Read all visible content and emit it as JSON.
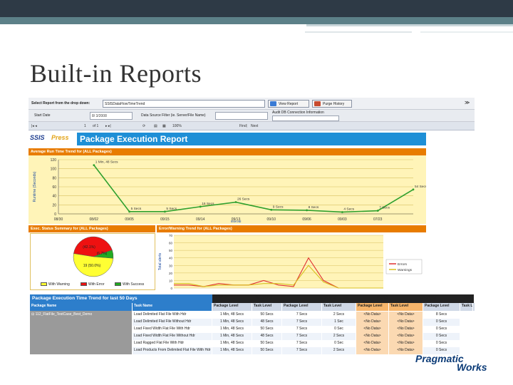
{
  "slide": {
    "title": "Built-in Reports",
    "logo_line1": "Pragmatic",
    "logo_line2": "Works"
  },
  "toolbar": {
    "select_label": "Select Report from the drop down:",
    "report_value": "SSISDataFlowTimeTrend",
    "view_button": "View Report",
    "purge_button": "Purge History",
    "start_date_label": "Start Date",
    "start_date_value": "8/ 3/2008",
    "filter_label": "Data Source Filter (ie. Server/File Name)",
    "audit_label": "Audit DB Connection Information",
    "page_current": "1",
    "page_of": "of 1",
    "zoom": "100%",
    "find": "Find",
    "next": "Next",
    "close_glyph": "≫"
  },
  "report": {
    "logo_ssis": "SSIS",
    "logo_press": "Press",
    "title": "Package Execution Report",
    "runtime_title": "Average Run Time Trend for (ALL Packages)",
    "status_title": "Exec. Status Summary for (ALL Packages)",
    "error_title": "Error/Warning Trend for (ALL Packages)",
    "table_title": "Package Execution Time Trend for last 50 Days"
  },
  "chart_data": [
    {
      "type": "line",
      "title": "Average Run Time Trend for (ALL Packages)",
      "ylabel": "Runtime (Seconds)",
      "xlabel": "Interval",
      "ylim": [
        0,
        120
      ],
      "yticks": [
        0,
        20,
        40,
        60,
        80,
        100,
        120
      ],
      "categories": [
        "08/30",
        "08/02",
        "09/05",
        "09/15",
        "09/14",
        "09/13",
        "09/10",
        "09/06",
        "09/03",
        "07/23"
      ],
      "series": [
        {
          "values": [
            null,
            108,
            5,
            5,
            16,
            26,
            9,
            8,
            4,
            7,
            54
          ],
          "labels": [
            "1 Min, 48 Secs",
            "5 Secs",
            "5 Secs",
            "16 Secs",
            "26 Secs",
            "9 Secs",
            "8 Secs",
            "4 Secs",
            "7 Secs",
            "54 Secs"
          ],
          "color": "#2ea02e"
        }
      ],
      "grid": true
    },
    {
      "type": "pie",
      "title": "Exec. Status Summary for (ALL Packages)",
      "slices": [
        {
          "label": "With Warning",
          "value": 25.0,
          "display": "",
          "color": "#ffff33"
        },
        {
          "label": "With Error",
          "value": 42.1,
          "display": "(42.1%)",
          "color": "#ee1111"
        },
        {
          "label": "With Success",
          "value": 6.7,
          "display": "",
          "color": "#22aa22"
        }
      ],
      "inner_labels": [
        "(42.1%)",
        "(6.7%)",
        "19 (50.0%)"
      ],
      "legend": [
        "With Warning",
        "With Error",
        "With Success"
      ],
      "legend_position": "bottom"
    },
    {
      "type": "line",
      "title": "Error/Warning Trend for (ALL Packages)",
      "ylabel": "Total alerts",
      "ylim": [
        0,
        70
      ],
      "yticks": [
        0,
        10,
        20,
        30,
        40,
        50,
        60,
        70
      ],
      "series": [
        {
          "name": "Errors",
          "color": "#e03030",
          "values": [
            4,
            4,
            2,
            6,
            4,
            4,
            10,
            4,
            2,
            40,
            10,
            0,
            0,
            0,
            0
          ]
        },
        {
          "name": "Warnings",
          "color": "#d8c020",
          "values": [
            6,
            6,
            2,
            4,
            4,
            4,
            6,
            6,
            4,
            30,
            8,
            0,
            0,
            0,
            0
          ]
        }
      ],
      "legend_position": "right"
    },
    {
      "type": "table",
      "title": "Package Execution Time Trend for last 50 Days",
      "date_headers": [
        "09/08/2008",
        "09/02/2008",
        "?/26/08",
        "08/20/2008",
        "08/1"
      ],
      "columns": [
        "Package Name",
        "Task Name",
        "Package Level",
        "Task Level",
        "Package Level",
        "Task Level",
        "Package Level",
        "Task Level",
        "Package Level",
        "Task Level",
        "Pa"
      ],
      "package": "112_FlatFile_TestCase_Best_Demo",
      "rows": [
        [
          "Load Delimited Flat File With Hdr",
          "1 Min, 48 Secs",
          "50 Secs",
          "7 Secs",
          "2 Secs",
          "<No Data>",
          "<No Data>",
          "8 Secs"
        ],
        [
          "Load Delimited Flat File Without Hdr",
          "1 Min, 48 Secs",
          "48 Secs",
          "7 Secs",
          "1 Sec",
          "<No Data>",
          "<No Data>",
          "0 Secs"
        ],
        [
          "Load Fixed Width Flat File With Hdr",
          "1 Min, 48 Secs",
          "50 Secs",
          "7 Secs",
          "0 Sec",
          "<No Data>",
          "<No Data>",
          "0 Secs"
        ],
        [
          "Load Fixed Width Flat File Without Hdr",
          "1 Min, 48 Secs",
          "48 Secs",
          "7 Secs",
          "2 Secs",
          "<No Data>",
          "<No Data>",
          "0 Secs"
        ],
        [
          "Load Ragged Flat File With Hdr",
          "1 Min, 48 Secs",
          "50 Secs",
          "7 Secs",
          "0 Sec",
          "<No Data>",
          "<No Data>",
          "0 Secs"
        ],
        [
          "Load Products From Delimited Flat File With Hdr",
          "1 Min, 48 Secs",
          "50 Secs",
          "7 Secs",
          "2 Secs",
          "<No Data>",
          "<No Data>",
          "0 Secs"
        ]
      ]
    }
  ]
}
